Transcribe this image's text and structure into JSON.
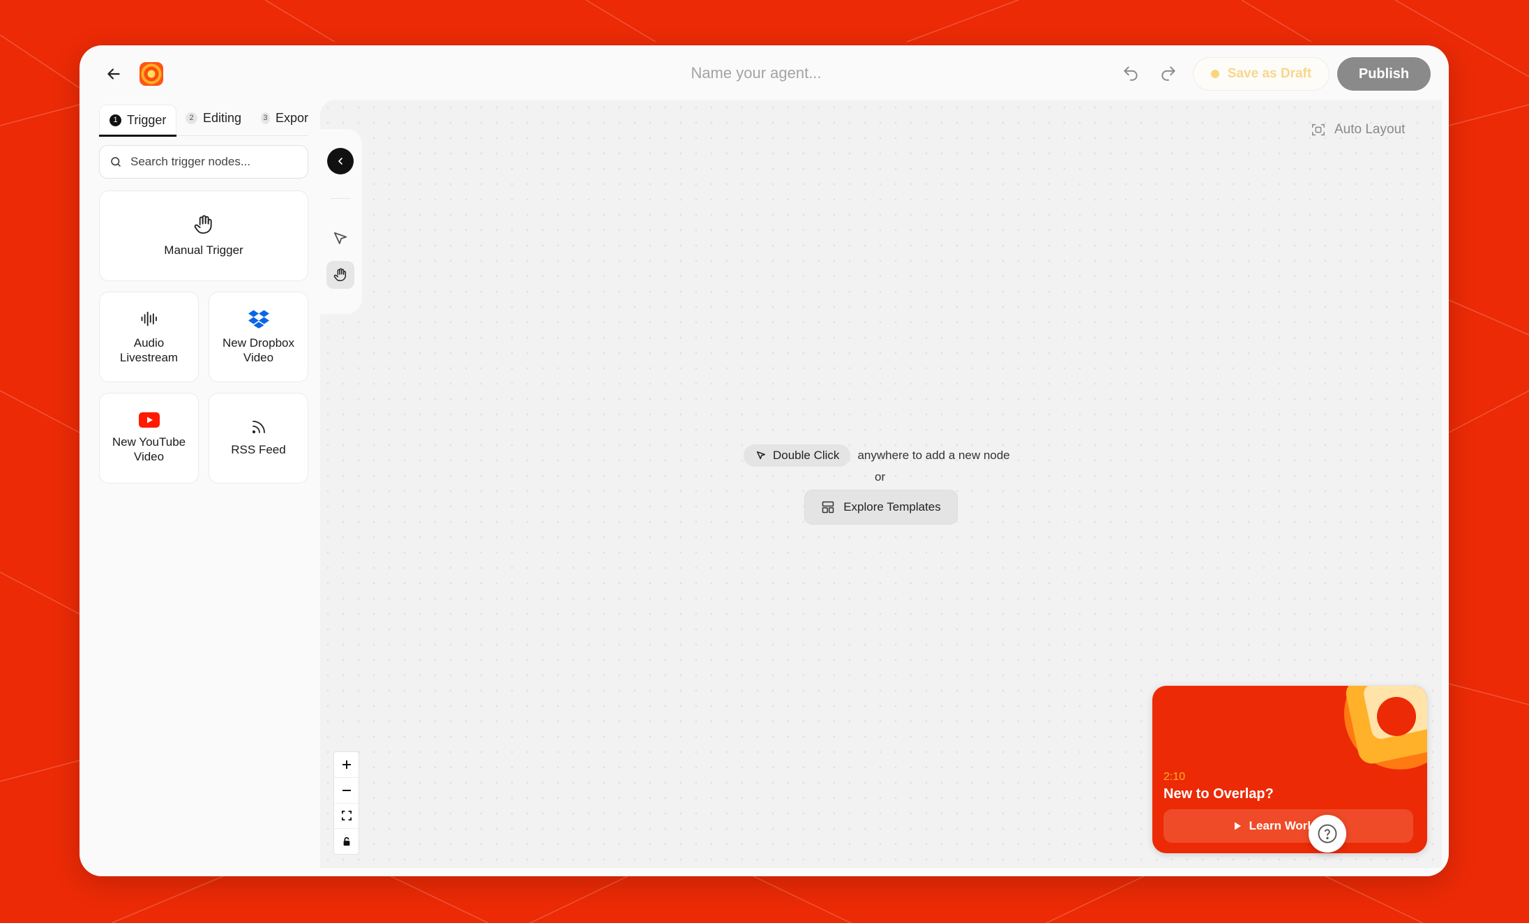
{
  "header": {
    "agent_name_placeholder": "Name your agent...",
    "save_draft_label": "Save as Draft",
    "publish_label": "Publish"
  },
  "sidebar": {
    "tabs": [
      {
        "num": "1",
        "label": "Trigger",
        "active": true
      },
      {
        "num": "2",
        "label": "Editing",
        "active": false
      },
      {
        "num": "3",
        "label": "Expor",
        "active": false
      }
    ],
    "search_placeholder": "Search trigger nodes...",
    "nodes": [
      {
        "label": "Manual Trigger",
        "icon": "hand-icon"
      },
      {
        "label": "Audio Livestream",
        "icon": "audio-waveform-icon"
      },
      {
        "label": "New Dropbox Video",
        "icon": "dropbox-icon"
      },
      {
        "label": "New YouTube Video",
        "icon": "youtube-icon"
      },
      {
        "label": "RSS Feed",
        "icon": "rss-icon"
      }
    ]
  },
  "canvas": {
    "auto_layout_label": "Auto Layout",
    "double_click_label": "Double Click",
    "hint_text": "anywhere to add a new node",
    "or_text": "or",
    "explore_templates_label": "Explore Templates"
  },
  "promo": {
    "duration": "2:10",
    "title": "New to Overlap?",
    "button_label": "Learn Workflows"
  },
  "colors": {
    "background": "#ec2a06",
    "accent_yellow": "#ffb020",
    "publish_gray": "#8a8a8a"
  }
}
